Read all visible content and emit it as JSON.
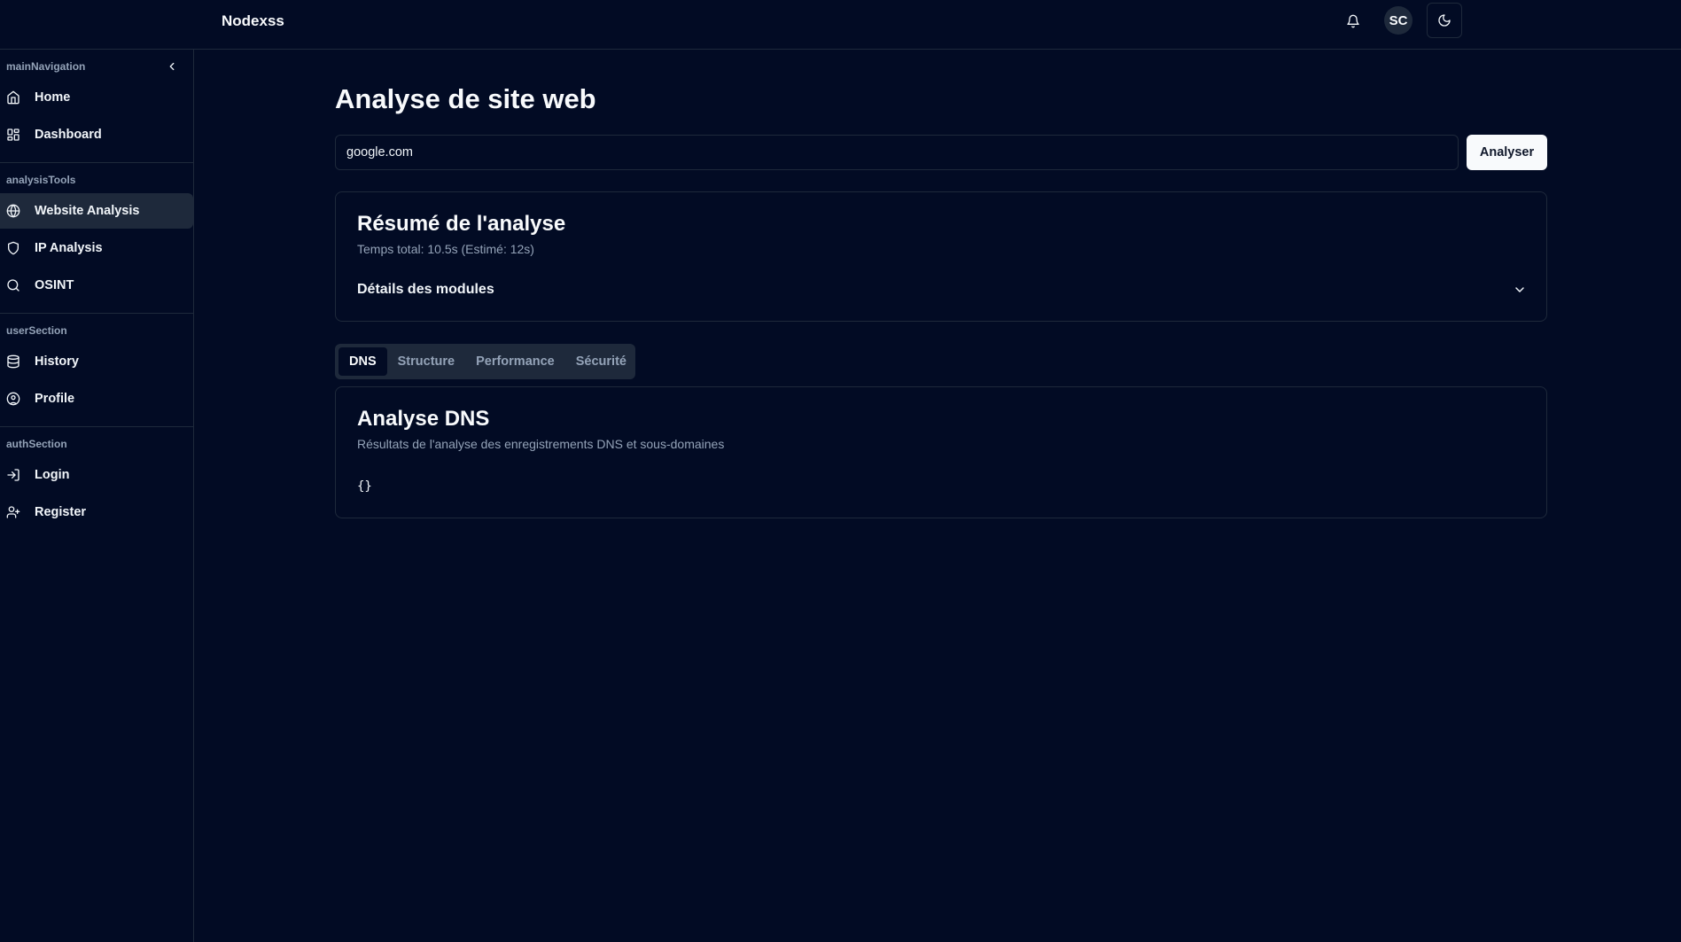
{
  "app": {
    "name": "Nodexss"
  },
  "header": {
    "avatar_initials": "SC",
    "icons": {
      "notifications": "bell-icon",
      "theme": "moon-icon"
    }
  },
  "sidebar": {
    "sections": [
      {
        "title": "mainNavigation",
        "items": [
          {
            "label": "Home",
            "icon": "home-icon"
          },
          {
            "label": "Dashboard",
            "icon": "dashboard-icon"
          }
        ]
      },
      {
        "title": "analysisTools",
        "items": [
          {
            "label": "Website Analysis",
            "icon": "globe-icon",
            "active": true
          },
          {
            "label": "IP Analysis",
            "icon": "shield-icon"
          },
          {
            "label": "OSINT",
            "icon": "search-icon"
          }
        ]
      },
      {
        "title": "userSection",
        "items": [
          {
            "label": "History",
            "icon": "database-icon"
          },
          {
            "label": "Profile",
            "icon": "user-circle-icon"
          }
        ]
      },
      {
        "title": "authSection",
        "items": [
          {
            "label": "Login",
            "icon": "login-icon"
          },
          {
            "label": "Register",
            "icon": "user-plus-icon"
          }
        ]
      }
    ]
  },
  "main": {
    "title": "Analyse de site web",
    "url_input": {
      "value": "google.com"
    },
    "analyse_button": "Analyser",
    "summary": {
      "title": "Résumé de l'analyse",
      "subtitle": "Temps total: 10.5s (Estimé: 12s)",
      "details_label": "Détails des modules"
    },
    "tabs": [
      {
        "label": "DNS",
        "active": true
      },
      {
        "label": "Structure"
      },
      {
        "label": "Performance"
      },
      {
        "label": "Sécurité"
      }
    ],
    "dns": {
      "title": "Analyse DNS",
      "subtitle": "Résultats de l'analyse des enregistrements DNS et sous-domaines",
      "output": "{}"
    }
  },
  "colors": {
    "background": "#020b24",
    "border": "#1e293b",
    "text": "#f8fafc",
    "muted": "#94a3b8"
  }
}
